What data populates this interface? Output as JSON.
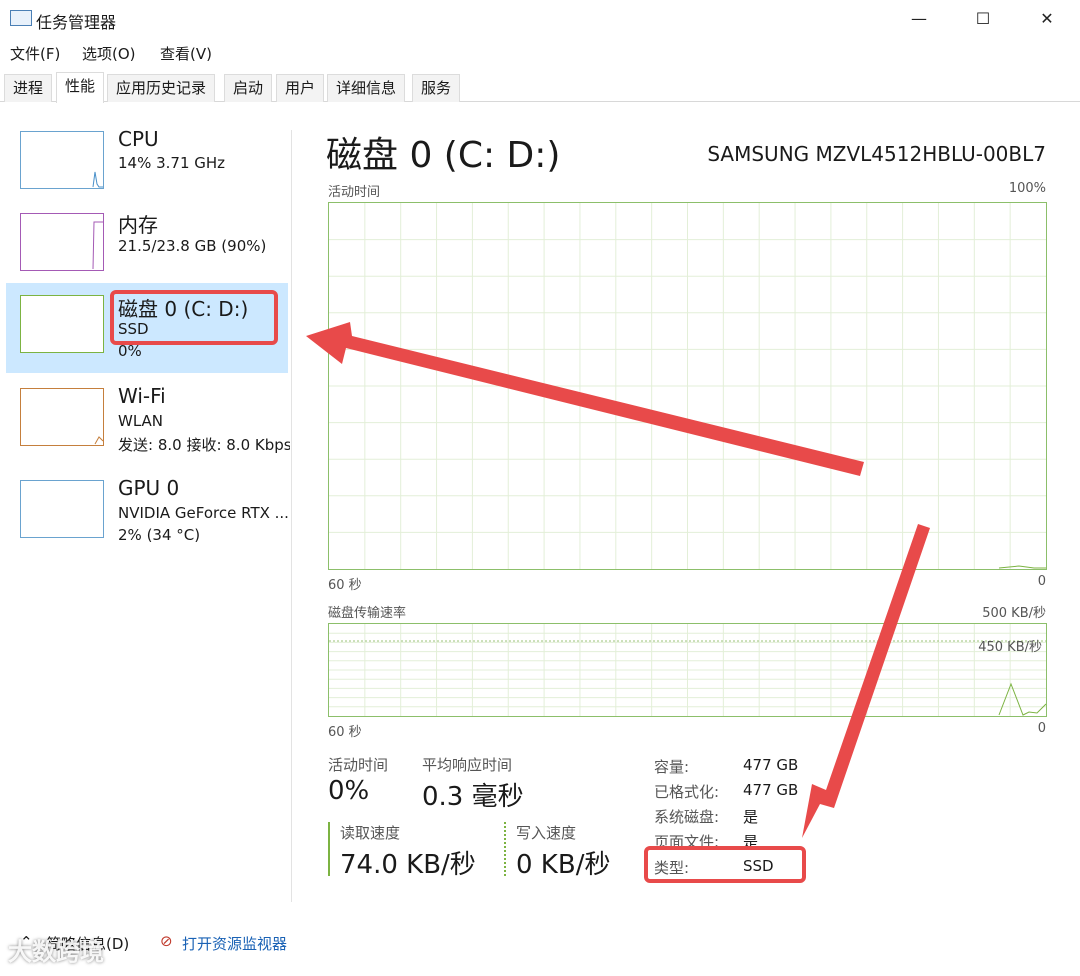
{
  "window": {
    "title": "任务管理器",
    "minimize": "—",
    "maximize": "☐",
    "close": "✕"
  },
  "menu": [
    "文件(F)",
    "选项(O)",
    "查看(V)"
  ],
  "tabs": [
    "进程",
    "性能",
    "应用历史记录",
    "启动",
    "用户",
    "详细信息",
    "服务"
  ],
  "sidebar": {
    "items": [
      {
        "name": "CPU",
        "sub1": "14%  3.71 GHz",
        "sub2": ""
      },
      {
        "name": "内存",
        "sub1": "21.5/23.8 GB (90%)",
        "sub2": ""
      },
      {
        "name": "磁盘 0 (C: D:)",
        "sub1": "SSD",
        "sub2": "0%"
      },
      {
        "name": "Wi-Fi",
        "sub1": "WLAN",
        "sub2": "发送: 8.0  接收: 8.0 Kbps"
      },
      {
        "name": "GPU 0",
        "sub1": "NVIDIA GeForce RTX ...",
        "sub2": "2% (34 °C)"
      }
    ]
  },
  "main": {
    "title": "磁盘 0 (C: D:)",
    "model": "SAMSUNG MZVL4512HBLU-00BL7",
    "graph1": {
      "label": "活动时间",
      "max": "100%",
      "time": "60 秒",
      "min": "0"
    },
    "graph2": {
      "label": "磁盘传输速率",
      "max": "500 KB/秒",
      "mark": "450 KB/秒",
      "time": "60 秒",
      "min": "0"
    },
    "stats": {
      "active_label": "活动时间",
      "active_value": "0%",
      "resp_label": "平均响应时间",
      "resp_value": "0.3 毫秒",
      "read_label": "读取速度",
      "read_value": "74.0 KB/秒",
      "write_label": "写入速度",
      "write_value": "0 KB/秒"
    },
    "props": [
      {
        "key": "容量:",
        "value": "477 GB"
      },
      {
        "key": "已格式化:",
        "value": "477 GB"
      },
      {
        "key": "系统磁盘:",
        "value": "是"
      },
      {
        "key": "页面文件:",
        "value": "是"
      },
      {
        "key": "类型:",
        "value": "SSD"
      }
    ]
  },
  "footer": {
    "summary": "简略信息(D)",
    "monitor": "打开资源监视器"
  },
  "watermark": "大数跨境",
  "colors": {
    "accent": "#cce8ff",
    "disk_green": "#7cb342",
    "annotation_red": "#e84a4a"
  }
}
